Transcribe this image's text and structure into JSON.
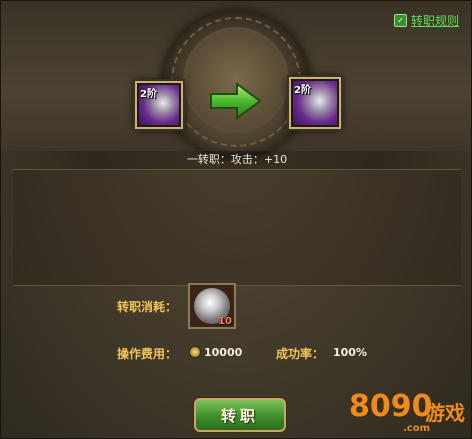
{
  "rule_link": {
    "label": "转职规则"
  },
  "source_item": {
    "tier": "2阶"
  },
  "target_item": {
    "tier": "2阶"
  },
  "effect_text": "一转职：攻击：+10",
  "cost": {
    "material_label": "转职消耗：",
    "material_count": "10",
    "fee_label": "操作费用：",
    "fee_value": "10000",
    "rate_label": "成功率：",
    "rate_value": "100%"
  },
  "action_button": {
    "label": "转职"
  },
  "watermark": {
    "brand": "8090",
    "suffix": "游戏",
    "url": ".com"
  },
  "icons": {
    "rule": "help-icon",
    "arrow": "green-right-arrow-icon",
    "coin": "coin-icon"
  },
  "colors": {
    "link": "#5fe05a",
    "label_gold": "#f2c45a",
    "button_green": "#3e8f2c",
    "watermark_orange": "#f08a1c"
  }
}
